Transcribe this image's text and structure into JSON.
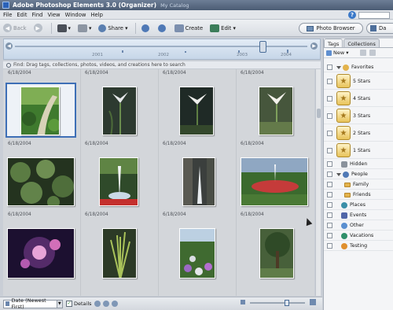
{
  "window": {
    "app_title": "Adobe Photoshop Elements 3.0 (Organizer)",
    "catalog": "My Catalog"
  },
  "menu": [
    "File",
    "Edit",
    "Find",
    "View",
    "Window",
    "Help"
  ],
  "help_button": "?",
  "toolbar": {
    "back": "Back",
    "share": "Share",
    "create": "Create",
    "edit": "Edit",
    "photo_browser": "Photo Browser",
    "date_view": "Da"
  },
  "timeline": {
    "years": [
      "2001",
      "2002",
      "2003",
      "2004"
    ]
  },
  "findbar": {
    "text": "Find: Drag tags, collections, photos, videos, and creations here to search"
  },
  "grid": {
    "row_dates": [
      [
        "6/18/2004",
        "6/18/2004",
        "6/18/2004",
        "6/18/2004"
      ],
      [
        "6/18/2004",
        "6/18/2004",
        "6/18/2004",
        "6/18/2004"
      ],
      [
        "6/18/2004",
        "6/18/2004",
        "6/18/2004",
        "6/18/2004"
      ]
    ]
  },
  "bottombar": {
    "sort": "Date (Newest First)",
    "details": "Details"
  },
  "right_panel": {
    "tabs": [
      "Tags",
      "Collections"
    ],
    "new_label": "New",
    "tags": [
      {
        "label": "Favorites"
      },
      {
        "label": "5 Stars"
      },
      {
        "label": "4 Stars"
      },
      {
        "label": "3 Stars"
      },
      {
        "label": "2 Stars"
      },
      {
        "label": "1 Stars"
      },
      {
        "label": "Hidden"
      },
      {
        "label": "People"
      },
      {
        "label": "Family"
      },
      {
        "label": "Friends"
      },
      {
        "label": "Places"
      },
      {
        "label": "Events"
      },
      {
        "label": "Other"
      },
      {
        "label": "Vacations"
      },
      {
        "label": "Testing"
      }
    ]
  },
  "colors": {
    "accent": "#3e6fb6",
    "panel": "#f4f5f7",
    "grid_bg": "#d3d6da"
  }
}
